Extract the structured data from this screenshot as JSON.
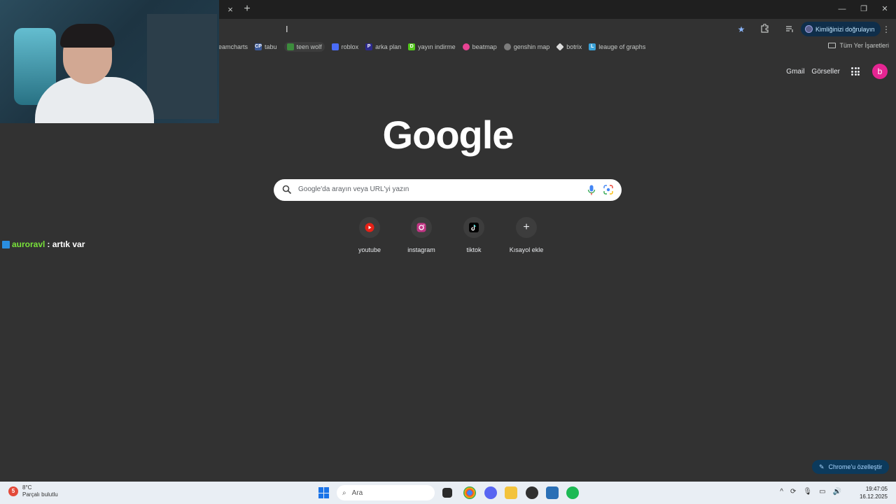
{
  "window": {
    "tab_close_glyph": "×",
    "new_tab_glyph": "+",
    "controls": {
      "minimize": "—",
      "restore": "❐",
      "close": "✕"
    }
  },
  "toolbar": {
    "verify_label": "Kimliğinizi doğrulayın"
  },
  "bookmarks": {
    "items": [
      {
        "label": "eamcharts",
        "icon": "teamcharts-icon",
        "color": "#323232"
      },
      {
        "label": "tabu",
        "icon": "cp-icon",
        "color": "#3c5a99"
      },
      {
        "label": "teen wolf",
        "icon": "teenwolf-icon",
        "color": "#3c8c3c"
      },
      {
        "label": "roblox",
        "icon": "roblox-icon",
        "color": "#4a6cf7"
      },
      {
        "label": "arka plan",
        "icon": "arkaplan-icon",
        "color": "#2d2a8c"
      },
      {
        "label": "yayın indirme",
        "icon": "download-icon",
        "color": "#53c81c"
      },
      {
        "label": "beatmap",
        "icon": "osu-icon",
        "color": "#e84393"
      },
      {
        "label": "genshin map",
        "icon": "genshin-icon",
        "color": "#7c7c7c"
      },
      {
        "label": "botrix",
        "icon": "botrix-icon",
        "color": "#dddddd"
      },
      {
        "label": "leauge of graphs",
        "icon": "log-icon",
        "color": "#3aa2d8"
      }
    ],
    "all_label": "Tüm Yer İşaretleri"
  },
  "ntp": {
    "gmail": "Gmail",
    "images": "Görseller",
    "avatar_letter": "b",
    "logo": "Google",
    "search_placeholder": "Google'da arayın veya URL'yi yazın",
    "shortcuts": [
      {
        "label": "youtube",
        "icon": "youtube-icon"
      },
      {
        "label": "instagram",
        "icon": "instagram-icon"
      },
      {
        "label": "tiktok",
        "icon": "tiktok-icon"
      },
      {
        "label": "Kısayol ekle",
        "icon": "add-icon"
      }
    ],
    "customize_label": "Chrome'u özelleştir"
  },
  "chat": {
    "user": "auroravl",
    "message": ": artık var"
  },
  "taskbar": {
    "weather_badge": "5",
    "temperature": "8°C",
    "weather_text": "Parçalı bulutlu",
    "search_label": "Ara",
    "time": "19:47:05",
    "date": "16.12.2025"
  },
  "colors": {
    "page_bg": "#323232",
    "tabstrip_bg": "#1f1f1f",
    "accent_blue": "#8ab4f8",
    "avatar_pink": "#e52592",
    "chat_user_green": "#79e33a"
  }
}
